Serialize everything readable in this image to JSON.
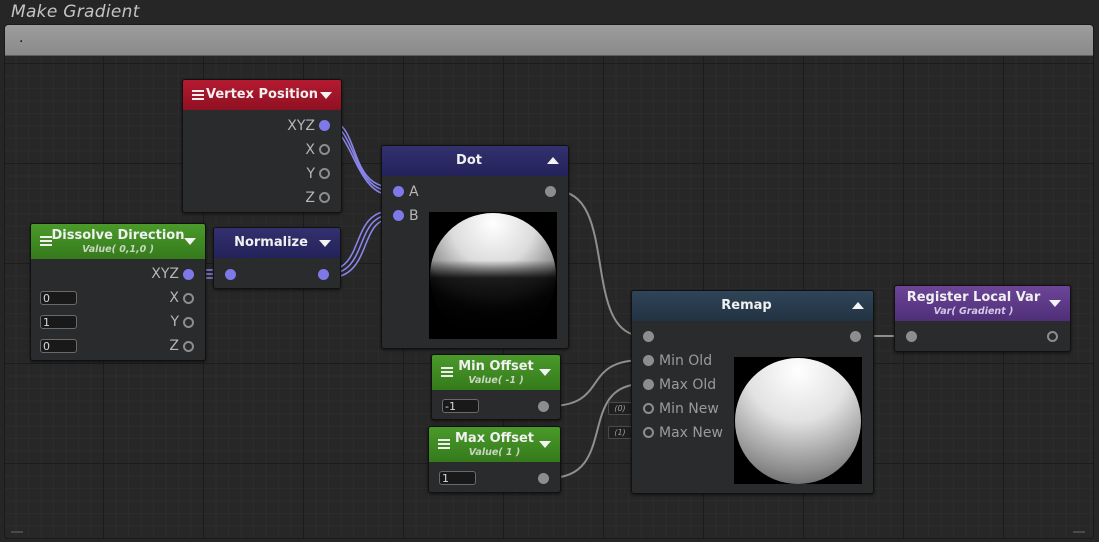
{
  "graph": {
    "title": "Make Gradient",
    "comment": "."
  },
  "nodes": {
    "vertex_position": {
      "title": "Vertex Position",
      "header_color": "#a3142a",
      "outputs": [
        "XYZ",
        "X",
        "Y",
        "Z"
      ]
    },
    "dissolve_direction": {
      "title": "Dissolve Direction",
      "subtitle": "Value( 0,1,0 )",
      "header_color": "#3f8a23",
      "output": "XYZ",
      "fields": [
        {
          "label": "X",
          "value": "0"
        },
        {
          "label": "Y",
          "value": "1"
        },
        {
          "label": "Z",
          "value": "0"
        }
      ]
    },
    "normalize": {
      "title": "Normalize",
      "header_color": "#2b2962"
    },
    "dot": {
      "title": "Dot",
      "header_color": "#2b2962",
      "inputs": [
        "A",
        "B"
      ]
    },
    "min_offset": {
      "title": "Min Offset",
      "subtitle": "Value( -1 )",
      "header_color": "#3f8a23",
      "value": "-1"
    },
    "max_offset": {
      "title": "Max Offset",
      "subtitle": "Value( 1 )",
      "header_color": "#3f8a23",
      "value": "1"
    },
    "remap": {
      "title": "Remap",
      "header_color": "#263848",
      "inputs": [
        "Min Old",
        "Max Old",
        "Min New",
        "Max New"
      ],
      "defaults": [
        "(0)",
        "(1)"
      ]
    },
    "register_local_var": {
      "title": "Register Local Var",
      "subtitle": "Var( Gradient )",
      "header_color": "#5e3a85"
    }
  },
  "icons": {
    "menu": "hamburger-menu-icon",
    "collapse": "triangle-down-icon",
    "expand": "triangle-up-icon",
    "port": "circle-port-icon"
  },
  "colors": {
    "vector_wire": "#8a84ea",
    "scalar_wire": "#9a9a9a"
  }
}
